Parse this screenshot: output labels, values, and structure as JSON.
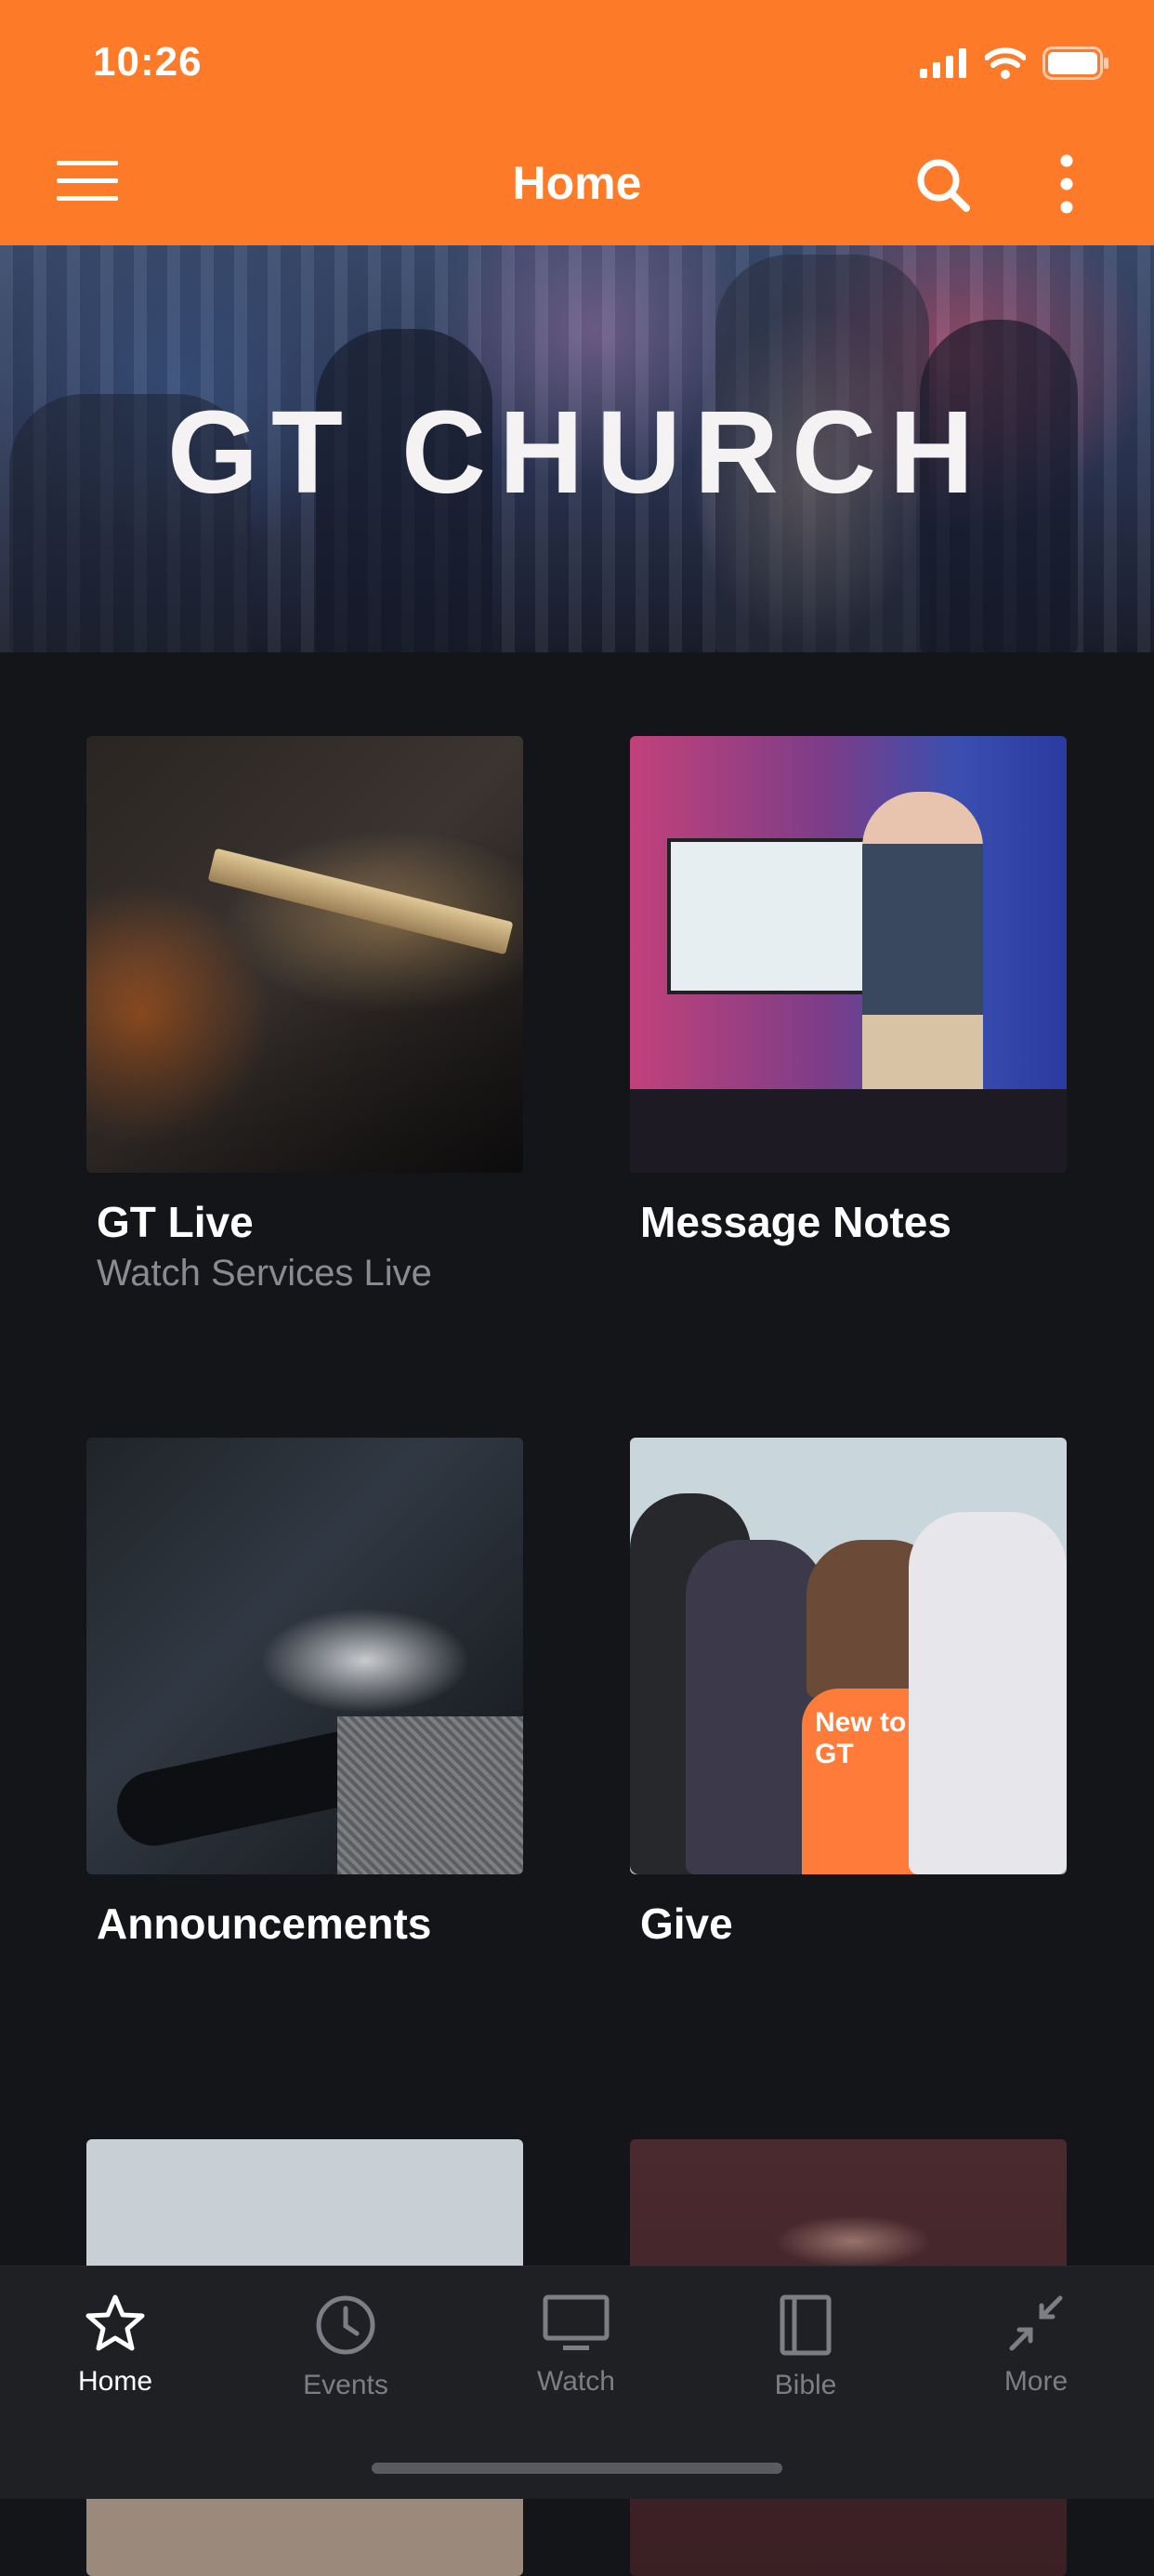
{
  "status": {
    "time": "10:26"
  },
  "header": {
    "title": "Home"
  },
  "banner": {
    "title": "GT CHURCH"
  },
  "cards": [
    {
      "title": "GT Live",
      "subtitle": "Watch Services Live"
    },
    {
      "title": "Message Notes",
      "subtitle": ""
    },
    {
      "title": "Announcements",
      "subtitle": ""
    },
    {
      "title": "Give",
      "subtitle": ""
    }
  ],
  "give_sign": "New to GT",
  "tabs": [
    {
      "label": "Home",
      "icon": "star-icon",
      "active": true
    },
    {
      "label": "Events",
      "icon": "clock-icon",
      "active": false
    },
    {
      "label": "Watch",
      "icon": "monitor-icon",
      "active": false
    },
    {
      "label": "Bible",
      "icon": "book-icon",
      "active": false
    },
    {
      "label": "More",
      "icon": "collapse-arrows-icon",
      "active": false
    }
  ],
  "colors": {
    "accent": "#fd7a29",
    "background": "#141518",
    "tabbar": "#1f2023"
  }
}
